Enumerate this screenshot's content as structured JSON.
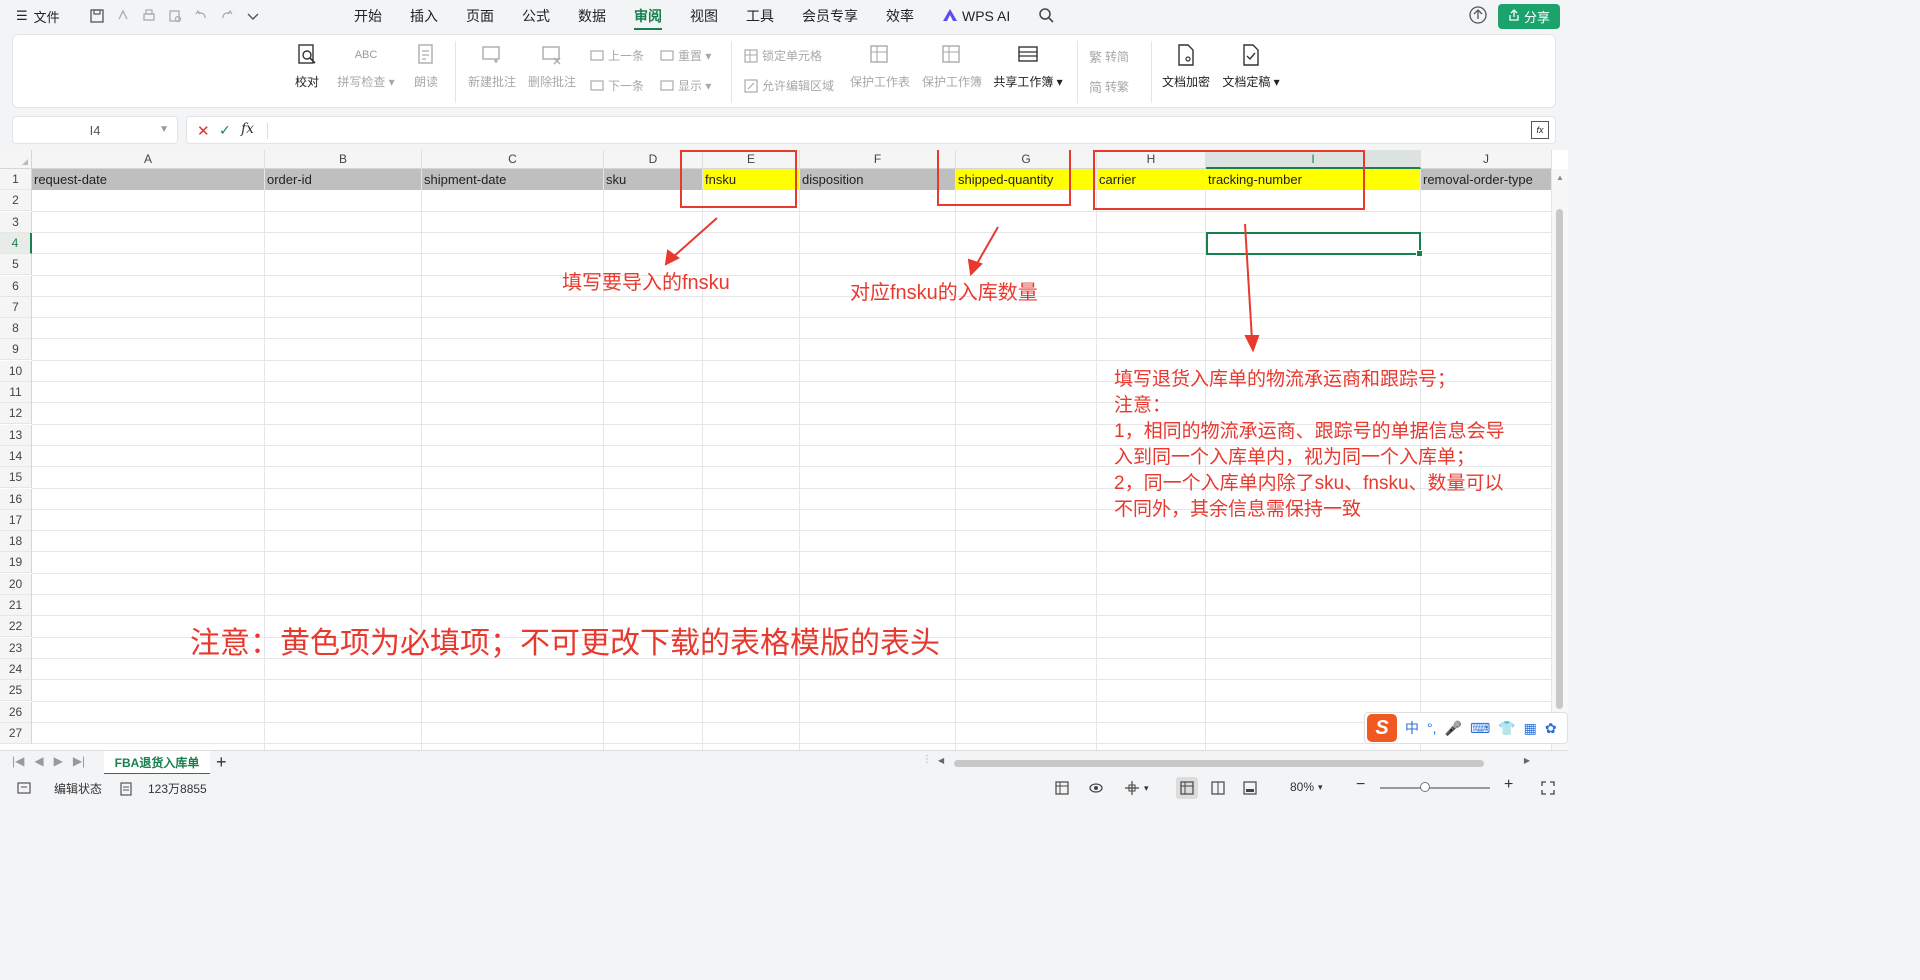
{
  "menubar": {
    "file_label": "文件",
    "tabs": [
      "开始",
      "插入",
      "页面",
      "公式",
      "数据",
      "审阅",
      "视图",
      "工具",
      "会员专享",
      "效率"
    ],
    "active_tab": "审阅",
    "wps_ai": "WPS AI",
    "share": "分享"
  },
  "ribbon": {
    "proofread": "校对",
    "spellcheck": "拼写检查",
    "spellcheck_abc": "ABC",
    "read_aloud": "朗读",
    "new_comment": "新建批注",
    "delete_comment": "删除批注",
    "prev": "上一条",
    "next": "下一条",
    "reset": "重置",
    "show": "显示",
    "lock_cell": "锁定单元格",
    "allow_edit": "允许编辑区域",
    "protect_sheet": "保护工作表",
    "protect_book": "保护工作簿",
    "share_book": "共享工作簿",
    "to_simplified": "转简",
    "to_traditional": "转繁",
    "doc_encrypt": "文档加密",
    "doc_finalize": "文档定稿"
  },
  "formula": {
    "cell_ref": "I4",
    "fx": "fx",
    "value": ""
  },
  "sheet": {
    "columns": [
      "A",
      "B",
      "C",
      "D",
      "E",
      "F",
      "G",
      "H",
      "I",
      "J"
    ],
    "rows": [
      1,
      2,
      3,
      4,
      5,
      6,
      7,
      8,
      9,
      10,
      11,
      12,
      13,
      14,
      15,
      16,
      17,
      18,
      19,
      20,
      21,
      22,
      23,
      24,
      25,
      26,
      27
    ],
    "selected_column": "I",
    "selected_row": 4,
    "headers": [
      {
        "col": "A",
        "text": "request-date",
        "required": false
      },
      {
        "col": "B",
        "text": "order-id",
        "required": false
      },
      {
        "col": "C",
        "text": "shipment-date",
        "required": false
      },
      {
        "col": "D",
        "text": "sku",
        "required": false
      },
      {
        "col": "E",
        "text": "fnsku",
        "required": true
      },
      {
        "col": "F",
        "text": "disposition",
        "required": false
      },
      {
        "col": "G",
        "text": "shipped-quantity",
        "required": true
      },
      {
        "col": "H",
        "text": "carrier",
        "required": true
      },
      {
        "col": "I",
        "text": "tracking-number",
        "required": true
      },
      {
        "col": "J",
        "text": "removal-order-type",
        "required": false
      }
    ],
    "header_gray": "#bfbfbf",
    "header_yellow": "#ffff00"
  },
  "annotations": {
    "fnsku_note": "填写要导入的fnsku",
    "quantity_note": "对应fnsku的入库数量",
    "carrier_note_lines": [
      "填写退货入库单的物流承运商和跟踪号；",
      "注意：",
      "1，相同的物流承运商、跟踪号的单据信息会导",
      "入到同一个入库单内，视为同一个入库单；",
      "2，同一个入库单内除了sku、fnsku、数量可以",
      "不同外，其余信息需保持一致"
    ],
    "main_note": "注意：黄色项为必填项；不可更改下载的表格模版的表头",
    "color": "#e8392f"
  },
  "ime": {
    "logo": "S",
    "lang": "中",
    "punct": "°,"
  },
  "sheet_tabs": {
    "active": "FBA退货入库单",
    "add": "+"
  },
  "status": {
    "edit_state": "编辑状态",
    "count": "123万8855",
    "zoom": "80%"
  },
  "colors": {
    "accent": "#18804d",
    "share_bg": "#1aa36b"
  }
}
